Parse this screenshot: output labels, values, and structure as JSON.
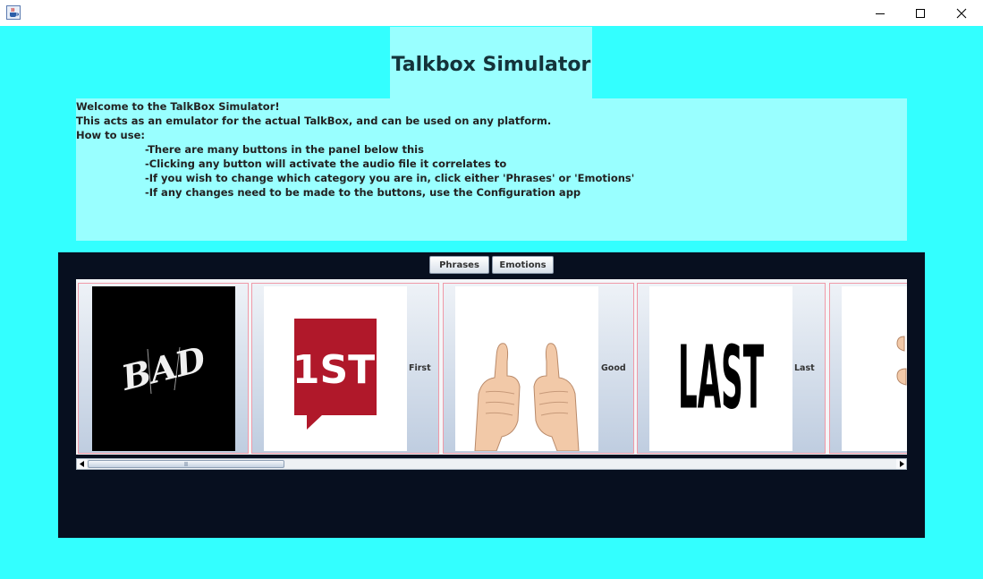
{
  "window": {
    "app_icon": "java-cup-icon",
    "controls": [
      "minimize-icon",
      "maximize-icon",
      "close-icon"
    ]
  },
  "title": "Talkbox Simulator",
  "welcome": {
    "lines": [
      "Welcome to the TalkBox Simulator!",
      "This acts as an emulator for the actual TalkBox, and can be used on any platform.",
      "How to use:"
    ],
    "instructions": [
      "-There are many buttons in the panel below this",
      "-Clicking any button will activate the audio file it correlates to",
      "-If you wish to change which category you are in, click either 'Phrases' or 'Emotions'",
      "-If any changes need to be made to the buttons, use the Configuration app"
    ]
  },
  "tabs": [
    "Phrases",
    "Emotions"
  ],
  "buttons": [
    {
      "label": "",
      "image": "bad-logo-image",
      "image_text": "BAD"
    },
    {
      "label": "First",
      "image": "first-badge-image",
      "image_text": "1ST"
    },
    {
      "label": "Good",
      "image": "thumbs-up-image"
    },
    {
      "label": "Last",
      "image": "last-text-image",
      "image_text": "LAST"
    },
    {
      "label": "",
      "image": "partial-image"
    }
  ],
  "colors": {
    "background": "#33ffff",
    "panel": "#99ffff",
    "button_panel": "#070f1f",
    "card_border": "#f09aa8",
    "first_red": "#b0182a"
  }
}
